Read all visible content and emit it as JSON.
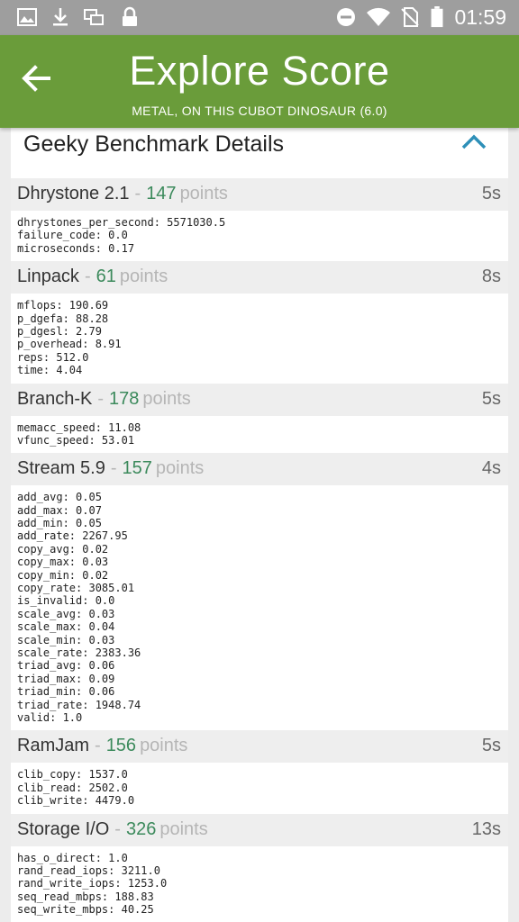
{
  "status_bar": {
    "time": "01:59",
    "icons": [
      "image-icon",
      "download-icon",
      "multi-window-icon",
      "lock-icon",
      "do-not-disturb-icon",
      "wifi-icon",
      "no-sim-icon",
      "battery-icon"
    ]
  },
  "header": {
    "title": "Explore Score",
    "subtitle": "METAL, ON THIS CUBOT DINOSAUR (6.0)",
    "color": "#6a9c3a"
  },
  "card": {
    "title": "Geeky Benchmark Details"
  },
  "benchmarks": [
    {
      "name": "Dhrystone 2.1",
      "sep": "-",
      "score": "147",
      "unit": "points",
      "time": "5s",
      "metrics": [
        "dhrystones_per_second: 5571030.5",
        "failure_code: 0.0",
        "microseconds: 0.17"
      ]
    },
    {
      "name": "Linpack",
      "sep": "-",
      "score": "61",
      "unit": "points",
      "time": "8s",
      "metrics": [
        "mflops: 190.69",
        "p_dgefa: 88.28",
        "p_dgesl: 2.79",
        "p_overhead: 8.91",
        "reps: 512.0",
        "time: 4.04"
      ]
    },
    {
      "name": "Branch-K",
      "sep": "-",
      "score": "178",
      "unit": "points",
      "time": "5s",
      "metrics": [
        "memacc_speed: 11.08",
        "vfunc_speed: 53.01"
      ]
    },
    {
      "name": "Stream 5.9",
      "sep": "-",
      "score": "157",
      "unit": "points",
      "time": "4s",
      "metrics": [
        "add_avg: 0.05",
        "add_max: 0.07",
        "add_min: 0.05",
        "add_rate: 2267.95",
        "copy_avg: 0.02",
        "copy_max: 0.03",
        "copy_min: 0.02",
        "copy_rate: 3085.01",
        "is_invalid: 0.0",
        "scale_avg: 0.03",
        "scale_max: 0.04",
        "scale_min: 0.03",
        "scale_rate: 2383.36",
        "triad_avg: 0.06",
        "triad_max: 0.09",
        "triad_min: 0.06",
        "triad_rate: 1948.74",
        "valid: 1.0"
      ]
    },
    {
      "name": "RamJam",
      "sep": "-",
      "score": "156",
      "unit": "points",
      "time": "5s",
      "metrics": [
        "clib_copy: 1537.0",
        "clib_read: 2502.0",
        "clib_write: 4479.0"
      ]
    },
    {
      "name": "Storage I/O",
      "sep": "-",
      "score": "326",
      "unit": "points",
      "time": "13s",
      "metrics": [
        "has_o_direct: 1.0",
        "rand_read_iops: 3211.0",
        "rand_write_iops: 1253.0",
        "seq_read_mbps: 188.83",
        "seq_write_mbps: 40.25"
      ]
    }
  ]
}
